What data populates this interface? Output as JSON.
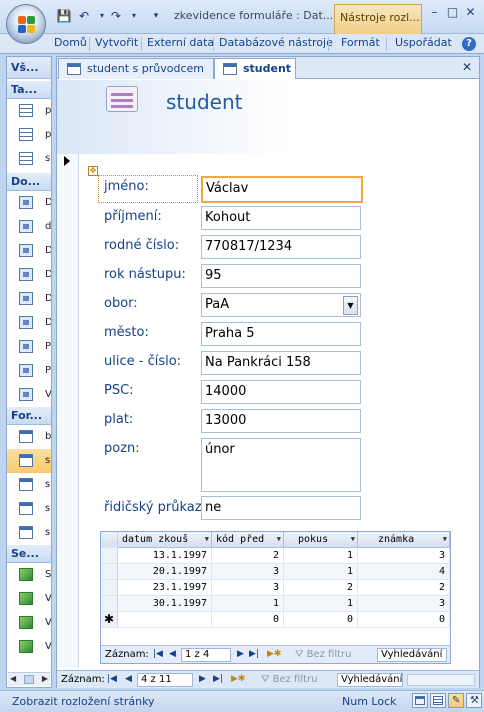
{
  "window": {
    "title": "zkevidence formuláře : Dat...",
    "contextual_tab": "Nástroje rozl...",
    "minimize": "–",
    "maximize": "□",
    "close": "✕"
  },
  "quick_access": {
    "save": "💾",
    "undo": "↶",
    "redo": "↷",
    "more": "▾"
  },
  "ribbon": {
    "tabs": [
      "Domů",
      "Vytvořit",
      "Externí data",
      "Databázové nástroje",
      "Formát",
      "Uspořádat"
    ],
    "help": "?"
  },
  "nav_pane": {
    "title": "Vš...",
    "groups": [
      {
        "label": "Ta...",
        "type": "table",
        "items": [
          "p",
          "p",
          "s"
        ]
      },
      {
        "label": "Do...",
        "type": "query",
        "items": [
          "D",
          "d",
          "D",
          "D",
          "D",
          "D",
          "P",
          "P",
          "V"
        ]
      },
      {
        "label": "For...",
        "type": "form",
        "items": [
          "b",
          "s",
          "s",
          "s",
          "s"
        ],
        "selected_index": 1
      },
      {
        "label": "Se...",
        "type": "macro",
        "items": [
          "S",
          "V",
          "V",
          "V"
        ]
      }
    ]
  },
  "doc_tabs": [
    {
      "label": "student s průvodcem",
      "active": false
    },
    {
      "label": "student",
      "active": true
    }
  ],
  "doc_close": "✕",
  "form": {
    "title": "student",
    "fields": [
      {
        "label": "jméno:",
        "value": "Václav"
      },
      {
        "label": "příjmení:",
        "value": "Kohout"
      },
      {
        "label": "rodné číslo:",
        "value": "770817/1234"
      },
      {
        "label": "rok nástupu:",
        "value": "95"
      },
      {
        "label": "obor:",
        "value": "PaA"
      },
      {
        "label": "město:",
        "value": "Praha 5"
      },
      {
        "label": "ulice - číslo:",
        "value": "Na Pankráci 158"
      },
      {
        "label": "PSC:",
        "value": "14000"
      },
      {
        "label": "plat:",
        "value": "13000"
      },
      {
        "label": "pozn:",
        "value": "únor"
      },
      {
        "label": "řidičský průkaz",
        "value": "ne"
      }
    ]
  },
  "subform": {
    "columns": [
      "datum zkouš",
      "kód před",
      "pokus",
      "známka"
    ],
    "rows": [
      [
        "13.1.1997",
        "2",
        "1",
        "3"
      ],
      [
        "20.1.1997",
        "3",
        "1",
        "4"
      ],
      [
        "23.1.1997",
        "3",
        "2",
        "2"
      ],
      [
        "30.1.1997",
        "1",
        "1",
        "3"
      ],
      [
        "",
        "0",
        "0",
        "0"
      ]
    ],
    "new_row_marker": "✱",
    "nav": {
      "label": "Záznam:",
      "position": "1 z 4",
      "filter": "Bez filtru",
      "search": "Vyhledávání"
    }
  },
  "record_nav": {
    "label": "Záznam:",
    "position": "4 z 11",
    "filter": "Bez filtru",
    "search": "Vyhledávání"
  },
  "status": {
    "left": "Zobrazit rozložení stránky",
    "num_lock": "Num Lock"
  }
}
